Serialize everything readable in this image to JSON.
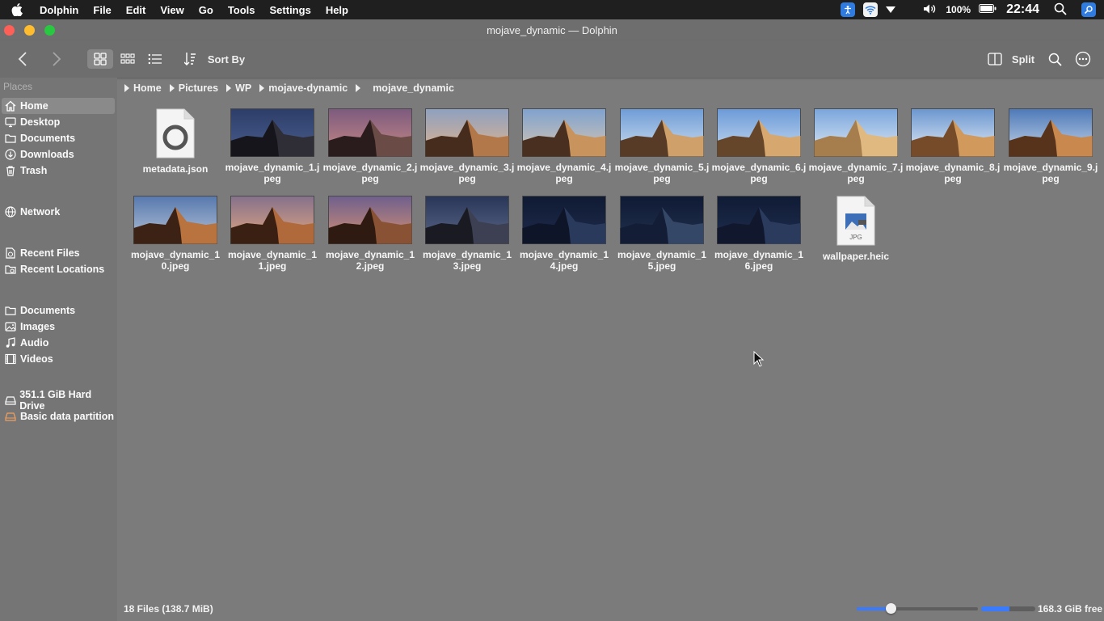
{
  "menubar": {
    "app": "Dolphin",
    "items": [
      "File",
      "Edit",
      "View",
      "Go",
      "Tools",
      "Settings",
      "Help"
    ],
    "battery": "100%",
    "clock": "22:44"
  },
  "window": {
    "title": "mojave_dynamic — Dolphin"
  },
  "toolbar": {
    "sort_label": "Sort By",
    "split_label": "Split"
  },
  "sidebar": {
    "places_header": "Places",
    "places": [
      {
        "label": "Home",
        "icon": "home-icon",
        "active": true
      },
      {
        "label": "Desktop",
        "icon": "desktop-icon"
      },
      {
        "label": "Documents",
        "icon": "documents-icon"
      },
      {
        "label": "Downloads",
        "icon": "downloads-icon"
      },
      {
        "label": "Trash",
        "icon": "trash-icon"
      }
    ],
    "network": {
      "label": "Network",
      "icon": "network-icon"
    },
    "recent": [
      {
        "label": "Recent Files",
        "icon": "recent-files-icon"
      },
      {
        "label": "Recent Locations",
        "icon": "recent-locations-icon"
      }
    ],
    "search": [
      {
        "label": "Documents",
        "icon": "documents-search-icon"
      },
      {
        "label": "Images",
        "icon": "images-icon"
      },
      {
        "label": "Audio",
        "icon": "audio-icon"
      },
      {
        "label": "Videos",
        "icon": "videos-icon"
      }
    ],
    "devices": [
      {
        "label": "351.1 GiB Hard Drive",
        "icon": "hard-drive-icon"
      },
      {
        "label": "Basic data partition",
        "icon": "partition-icon"
      }
    ]
  },
  "breadcrumb": [
    "Home",
    "Pictures",
    "WP",
    "mojave-dynamic",
    "mojave_dynamic"
  ],
  "files": [
    {
      "name": "metadata.json",
      "kind": "json"
    },
    {
      "name": "mojave_dynamic_1.jpeg",
      "kind": "img",
      "sky": "#2d3d6a",
      "sky2": "#4a5f8c",
      "dune": "#2f2d35",
      "shadow": "#14131a"
    },
    {
      "name": "mojave_dynamic_2.jpeg",
      "kind": "img",
      "sky": "#7c5a7e",
      "sky2": "#c98a86",
      "dune": "#6a4b45",
      "shadow": "#231718"
    },
    {
      "name": "mojave_dynamic_3.jpeg",
      "kind": "img",
      "sky": "#8ea0c0",
      "sky2": "#e0b48d",
      "dune": "#b3784a",
      "shadow": "#3a2317"
    },
    {
      "name": "mojave_dynamic_4.jpeg",
      "kind": "img",
      "sky": "#7fa2cf",
      "sky2": "#d8c6b0",
      "dune": "#c8935c",
      "shadow": "#3b2519"
    },
    {
      "name": "mojave_dynamic_5.jpeg",
      "kind": "img",
      "sky": "#6f9cd6",
      "sky2": "#cfe0f0",
      "dune": "#d0a06a",
      "shadow": "#4a3020"
    },
    {
      "name": "mojave_dynamic_6.jpeg",
      "kind": "img",
      "sky": "#6c9ad8",
      "sky2": "#c8dcf0",
      "dune": "#d6a870",
      "shadow": "#5a3b24"
    },
    {
      "name": "mojave_dynamic_7.jpeg",
      "kind": "img",
      "sky": "#7aa6dc",
      "sky2": "#dfe9f4",
      "dune": "#e0b980",
      "shadow": "#a07746"
    },
    {
      "name": "mojave_dynamic_8.jpeg",
      "kind": "img",
      "sky": "#6b96cf",
      "sky2": "#e6eef7",
      "dune": "#d19a5c",
      "shadow": "#6a4325"
    },
    {
      "name": "mojave_dynamic_9.jpeg",
      "kind": "img",
      "sky": "#4e79b8",
      "sky2": "#c7d7ea",
      "dune": "#c9884d",
      "shadow": "#4a2a16"
    },
    {
      "name": "mojave_dynamic_10.jpeg",
      "kind": "img",
      "sky": "#5779ae",
      "sky2": "#b7c4d8",
      "dune": "#b8733f",
      "shadow": "#2e1a10"
    },
    {
      "name": "mojave_dynamic_11.jpeg",
      "kind": "img",
      "sky": "#85718c",
      "sky2": "#e3a780",
      "dune": "#b0693a",
      "shadow": "#2c180e"
    },
    {
      "name": "mojave_dynamic_12.jpeg",
      "kind": "img",
      "sky": "#6f5f8d",
      "sky2": "#d49173",
      "dune": "#8a5234",
      "shadow": "#24140c"
    },
    {
      "name": "mojave_dynamic_13.jpeg",
      "kind": "img",
      "sky": "#2a3657",
      "sky2": "#5a6788",
      "dune": "#3d4052",
      "shadow": "#15161d"
    },
    {
      "name": "mojave_dynamic_14.jpeg",
      "kind": "img",
      "sky": "#101a33",
      "sky2": "#1e2c4c",
      "dune": "#2a3a5c",
      "shadow": "#0c1222"
    },
    {
      "name": "mojave_dynamic_15.jpeg",
      "kind": "img",
      "sky": "#0f1a34",
      "sky2": "#22314f",
      "dune": "#344767",
      "shadow": "#101830"
    },
    {
      "name": "mojave_dynamic_16.jpeg",
      "kind": "img",
      "sky": "#101b35",
      "sky2": "#1f2e4e",
      "dune": "#2b3b5e",
      "shadow": "#0e1529"
    },
    {
      "name": "wallpaper.heic",
      "kind": "jpg",
      "badge": "JPG"
    }
  ],
  "status": {
    "summary": "18 Files (138.7 MiB)",
    "free": "168.3 GiB free",
    "zoom_fraction": 0.28,
    "used_fraction": 0.52
  },
  "colors": {
    "accent": "#3a7bfd",
    "close": "#fe5f57",
    "minimize": "#febc2e",
    "maximize": "#28c840"
  }
}
